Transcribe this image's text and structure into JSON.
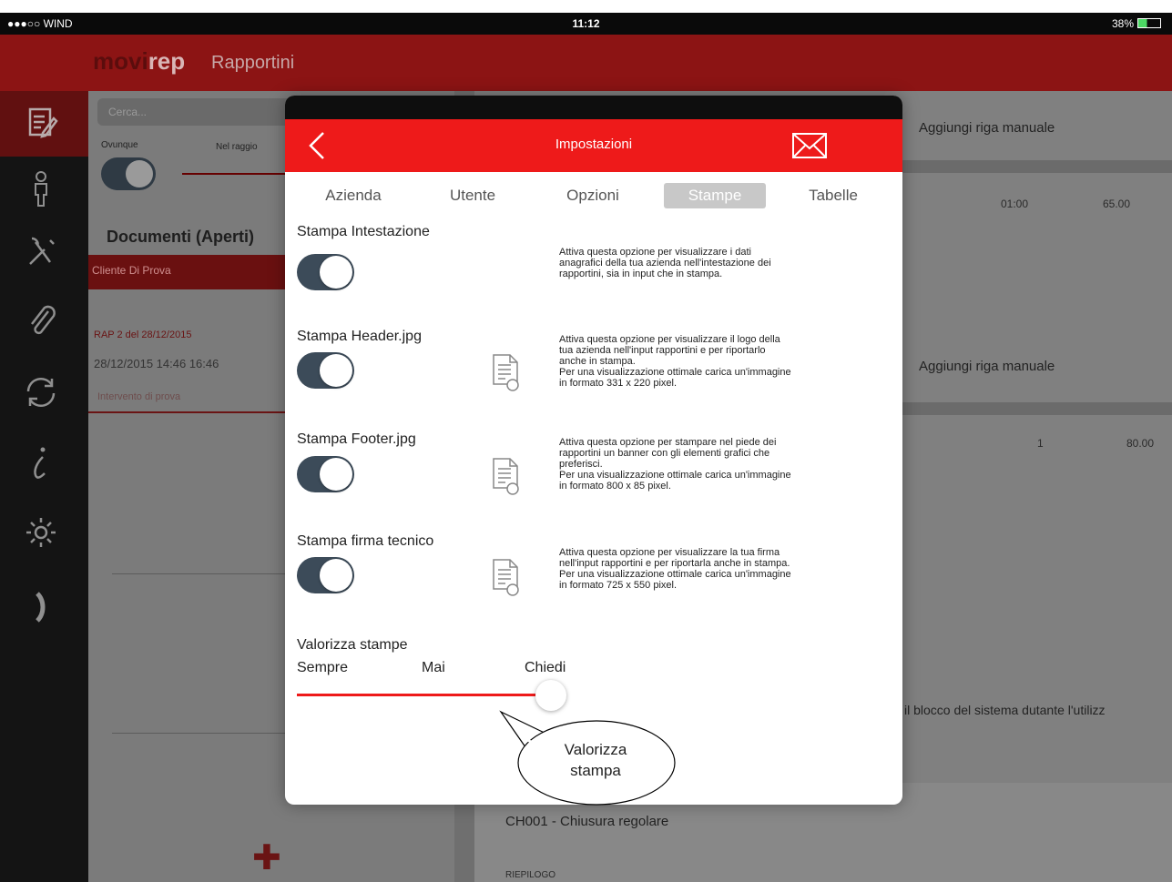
{
  "status_bar": {
    "carrier": "●●●○○ WIND",
    "time": "11:12",
    "battery": "38%"
  },
  "app": {
    "logo_a": "movi",
    "logo_b": "rep",
    "title": "Rapportini"
  },
  "sidebar_icons": [
    "report-icon",
    "person-icon",
    "tools-icon",
    "paperclip-icon",
    "sync-icon",
    "info-icon",
    "settings-icon",
    "arrow-icon"
  ],
  "list": {
    "search_placeholder": "Cerca...",
    "filter_anywhere": "Ovunque",
    "filter_radius": "Nel raggio",
    "section_title": "Documenti (Aperti)",
    "client": "Cliente Di Prova",
    "rap_number": "RAP 2 del 28/12/2015",
    "rap_datetime": "28/12/2015  14:46  16:46",
    "rap_description": "Intervento di prova"
  },
  "detail": {
    "add_row_1": "Aggiungi riga manuale",
    "time_value": "01:00",
    "amount_1": "65.00",
    "add_row_2": "Aggiungi riga manuale",
    "qty": "1",
    "amount_2": "80.00",
    "lock_notice": "il blocco del sistema dutante l'utilizz",
    "closure": "CH001 - Chiusura regolare",
    "riepilogo": "RIEPILOGO"
  },
  "modal": {
    "title": "Impostazioni",
    "tabs": [
      "Azienda",
      "Utente",
      "Opzioni",
      "Stampe",
      "Tabelle"
    ],
    "selected_tab": "Stampe",
    "settings": [
      {
        "title": "Stampa Intestazione",
        "enabled": true,
        "description": "Attiva questa opzione per visualizzare i dati\nanagrafici della tua azienda nell'intestazione dei\nrapportini, sia in input che in stampa."
      },
      {
        "title": "Stampa Header.jpg",
        "enabled": true,
        "description": "Attiva questa opzione per visualizzare il logo della\ntua azienda nell'input rapportini e per riportarlo\nanche in stampa.\nPer una visualizzazione ottimale carica un'immagine\nin formato 331 x 220 pixel."
      },
      {
        "title": "Stampa Footer.jpg",
        "enabled": true,
        "description": "Attiva questa opzione per stampare nel piede dei\nrapportini un banner con gli elementi grafici che\npreferisci.\nPer una visualizzazione ottimale carica un'immagine\nin formato 800 x 85 pixel."
      },
      {
        "title": "Stampa firma tecnico",
        "enabled": true,
        "description": "Attiva questa opzione per visualizzare la tua firma\nnell'input rapportini e per riportarla anche in stampa.\nPer una visualizzazione ottimale carica un'immagine\nin formato 725 x 550 pixel."
      }
    ],
    "valorizza": {
      "title": "Valorizza stampe",
      "options": [
        "Sempre",
        "Mai",
        "Chiedi"
      ],
      "selected": "Chiedi"
    }
  },
  "callout_text": "Valorizza\nstampa",
  "colors": {
    "accent_red": "#ee1a1a",
    "toggle_on": "#3c4b59",
    "app_bar_dimmed": "#8c1414"
  }
}
